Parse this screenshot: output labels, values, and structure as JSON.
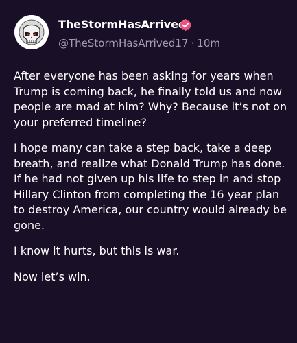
{
  "post": {
    "display_name": "TheStormHasArrived",
    "handle": "@TheStormHasArrived17",
    "separator": "·",
    "time": "10m",
    "paragraphs": [
      "After everyone has been asking for years when Trump is coming back, he finally told us and now people are mad at him? Why? Because it’s not on your preferred timeline?",
      "I hope many can take a step back, take a deep breath, and realize what Donald Trump has done. If he had not given up his life to step in and stop Hillary Clinton from completing the 16 year plan to destroy America, our country would already be gone.",
      "I know it hurts, but this is war.",
      "Now let’s win."
    ]
  },
  "icons": {
    "avatar": "skull-emblem-avatar",
    "verified": "verified-badge-icon"
  },
  "colors": {
    "background": "#190f26",
    "text": "#ffffff",
    "secondary_text": "#a49cb0",
    "verified_badge": "#e8547f"
  }
}
